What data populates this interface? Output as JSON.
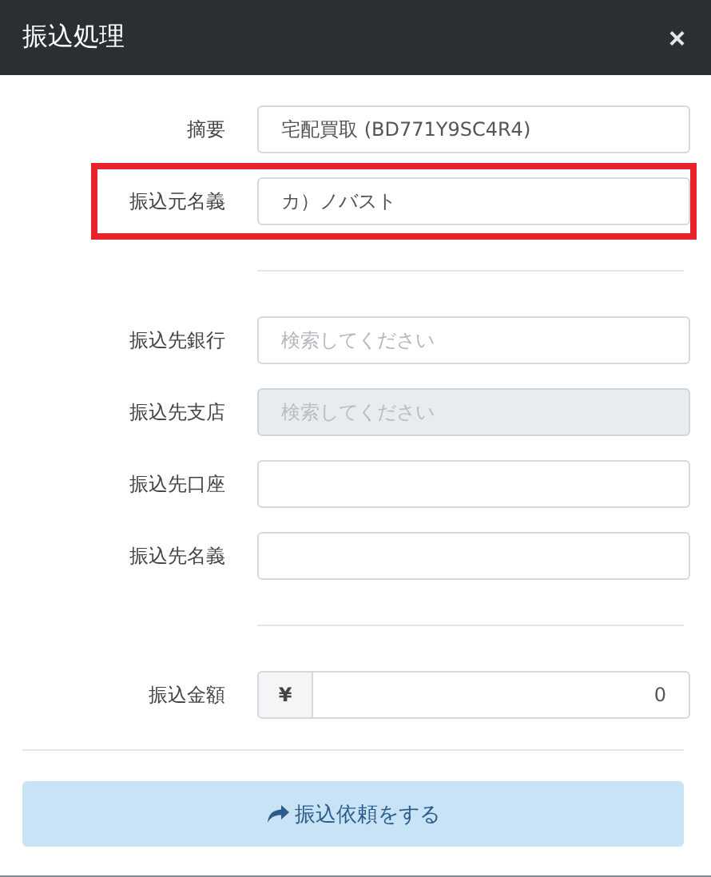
{
  "dialog": {
    "title": "振込処理",
    "close": "×"
  },
  "sections": [
    {
      "rows": [
        {
          "kind": "text",
          "label": "摘要",
          "value": "宅配買取 (BD771Y9SC4R4)",
          "highlighted": false,
          "disabled": false
        },
        {
          "kind": "text",
          "label": "振込元名義",
          "value": "カ）ノバスト",
          "highlighted": true,
          "disabled": false
        }
      ]
    },
    {
      "rows": [
        {
          "kind": "text",
          "label": "振込先銀行",
          "placeholder": "検索してください",
          "highlighted": false,
          "disabled": false
        },
        {
          "kind": "text",
          "label": "振込先支店",
          "placeholder": "検索してください",
          "highlighted": false,
          "disabled": true
        },
        {
          "kind": "text",
          "label": "振込先口座",
          "highlighted": false,
          "disabled": false
        },
        {
          "kind": "text",
          "label": "振込先名義",
          "highlighted": false,
          "disabled": false
        }
      ]
    },
    {
      "rows": [
        {
          "kind": "currency",
          "label": "振込金額",
          "prefix": "¥",
          "value": "0",
          "highlighted": false,
          "disabled": false
        }
      ]
    }
  ],
  "submit": {
    "label": "振込依頼をする"
  }
}
